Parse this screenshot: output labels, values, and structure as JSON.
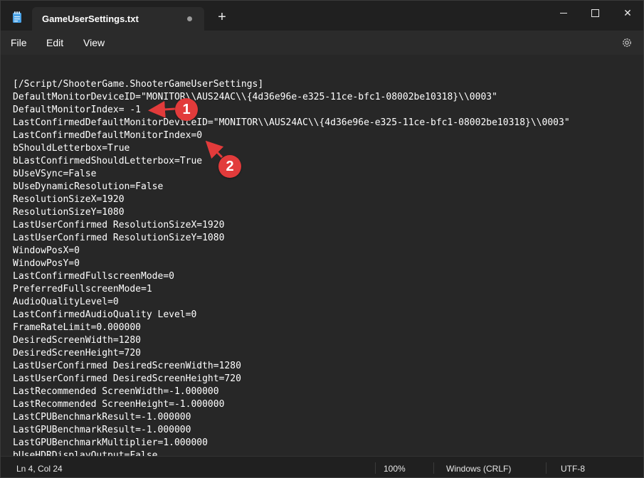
{
  "window": {
    "tab_title": "GameUserSettings.txt",
    "new_tab_symbol": "+",
    "close_symbol": "✕"
  },
  "menu": {
    "file": "File",
    "edit": "Edit",
    "view": "View"
  },
  "editor": {
    "lines": [
      "[/Script/ShooterGame.ShooterGameUserSettings]",
      "DefaultMonitorDeviceID=\"MONITOR\\\\AUS24AC\\\\{4d36e96e-e325-11ce-bfc1-08002be10318}\\\\0003\"",
      "DefaultMonitorIndex= -1",
      "LastConfirmedDefaultMonitorDeviceID=\"MONITOR\\\\AUS24AC\\\\{4d36e96e-e325-11ce-bfc1-08002be10318}\\\\0003\"",
      "LastConfirmedDefaultMonitorIndex=0",
      "bShouldLetterbox=True",
      "bLastConfirmedShouldLetterbox=True",
      "bUseVSync=False",
      "bUseDynamicResolution=False",
      "ResolutionSizeX=1920",
      "ResolutionSizeY=1080",
      "LastUserConfirmed ResolutionSizeX=1920",
      "LastUserConfirmed ResolutionSizeY=1080",
      "WindowPosX=0",
      "WindowPosY=0",
      "LastConfirmedFullscreenMode=0",
      "PreferredFullscreenMode=1",
      "AudioQualityLevel=0",
      "LastConfirmedAudioQuality Level=0",
      "FrameRateLimit=0.000000",
      "DesiredScreenWidth=1280",
      "DesiredScreenHeight=720",
      "LastUserConfirmed DesiredScreenWidth=1280",
      "LastUserConfirmed DesiredScreenHeight=720",
      "LastRecommended ScreenWidth=-1.000000",
      "LastRecommended ScreenHeight=-1.000000",
      "LastCPUBenchmarkResult=-1.000000",
      "LastGPUBenchmarkResult=-1.000000",
      "LastGPUBenchmarkMultiplier=1.000000",
      "bUseHDRDisplayOutput=False"
    ]
  },
  "annotations": {
    "marker_1": "1",
    "marker_2": "2",
    "color": "#e23b3b"
  },
  "status": {
    "position": "Ln 4, Col 24",
    "zoom": "100%",
    "line_ending": "Windows (CRLF)",
    "encoding": "UTF-8"
  }
}
